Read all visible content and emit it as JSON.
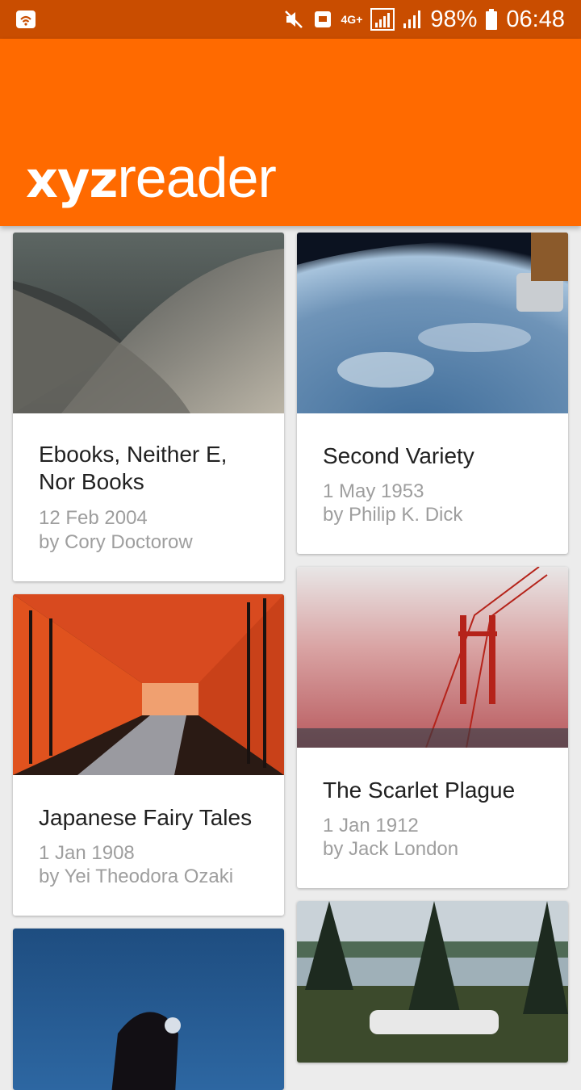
{
  "status_bar": {
    "network": "4G+",
    "battery": "98%",
    "time": "06:48"
  },
  "app_bar": {
    "logo_bold": "xyz",
    "logo_light": "reader"
  },
  "articles": [
    {
      "title_line1": "Ebooks, Neither E,",
      "title_line2": "Nor Books",
      "date": "12 Feb 2004",
      "author": "by Cory Doctorow"
    },
    {
      "title": "Second Variety",
      "date": "1 May 1953",
      "author": "by Philip K. Dick"
    },
    {
      "title": "Japanese Fairy Tales",
      "date": "1 Jan 1908",
      "author": "by Yei Theodora Ozaki"
    },
    {
      "title": "The Scarlet Plague",
      "date": "1 Jan 1912",
      "author": "by Jack London"
    }
  ]
}
